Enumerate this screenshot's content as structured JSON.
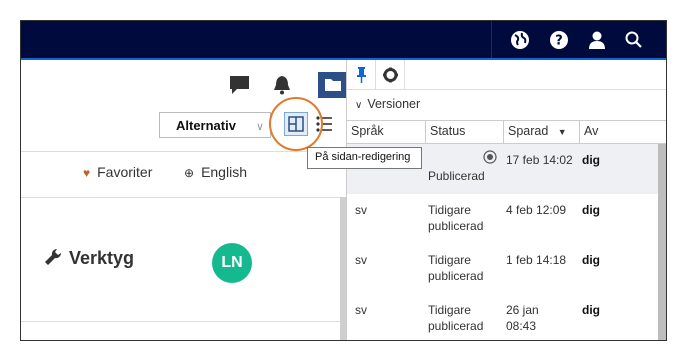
{
  "toolbar": {
    "alternativ_label": "Alternativ",
    "tooltip": "På sidan-redigering"
  },
  "links": {
    "favoriter": "Favoriter",
    "english": "English"
  },
  "tool": {
    "verktyg": "Verktyg",
    "avatar_initials": "LN"
  },
  "panel": {
    "section_title": "Versioner",
    "columns": [
      "Språk",
      "Status",
      "Sparad",
      "Av"
    ],
    "rows": [
      {
        "lang": "",
        "status": "Publicerad",
        "saved": "17 feb 14:02",
        "by": "dig"
      },
      {
        "lang": "sv",
        "status": "Tidigare publicerad",
        "saved": "4 feb 12:09",
        "by": "dig"
      },
      {
        "lang": "sv",
        "status": "Tidigare publicerad",
        "saved": "1 feb 14:18",
        "by": "dig"
      },
      {
        "lang": "sv",
        "status": "Tidigare publicerad",
        "saved": "26 jan 08:43",
        "by": "dig"
      }
    ]
  },
  "icons": {
    "topbar": [
      "globe-icon",
      "help-icon",
      "user-icon",
      "search-icon"
    ],
    "toolbar": [
      "comment-icon",
      "bell-icon",
      "folder-icon",
      "layout-icon",
      "list-icon"
    ]
  },
  "colors": {
    "topbar": "#000a3c",
    "accent": "#1464d2",
    "avatar": "#14b98f",
    "highlight": "#e07a2e"
  }
}
